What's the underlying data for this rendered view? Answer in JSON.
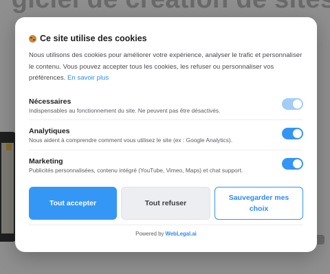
{
  "background": {
    "title": "giciel de création de sites"
  },
  "modal": {
    "title": "Ce site utilise des cookies",
    "icon": "cookie-icon",
    "description": "Nous utilisons des cookies pour améliorer votre expérience, analyser le trafic et personnaliser le contenu. Vous pouvez accepter tous les cookies, les refuser ou personnaliser vos préférences.",
    "learn_more": "En savoir plus",
    "categories": [
      {
        "name": "Nécessaires",
        "description": "Indispensables au fonctionnement du site. Ne peuvent pas être désactivés.",
        "enabled": true,
        "locked": true
      },
      {
        "name": "Analytiques",
        "description": "Nous aident à comprendre comment vous utilisez le site (ex : Google Analytics).",
        "enabled": true,
        "locked": false
      },
      {
        "name": "Marketing",
        "description": "Publicités personnalisées, contenu intégré (YouTube, Vimeo, Maps) et chat support.",
        "enabled": true,
        "locked": false
      }
    ],
    "buttons": {
      "accept": "Tout accepter",
      "refuse": "Tout refuser",
      "save": "Sauvegarder mes choix"
    },
    "footer": {
      "prefix": "Powered by",
      "brand": "WebLegal.ai"
    }
  },
  "colors": {
    "accent": "#3497f5",
    "link": "#2a8bf2",
    "toggle_disabled": "#a3cdf7"
  }
}
